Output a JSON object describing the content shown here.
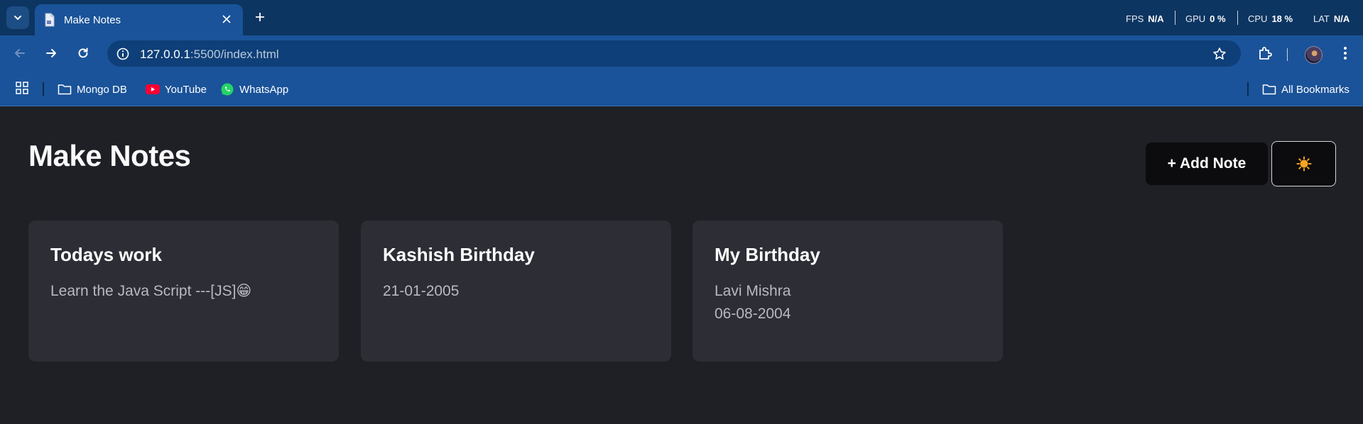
{
  "browser": {
    "tab": {
      "title": "Make Notes"
    },
    "perf": {
      "fps_label": "FPS",
      "fps_value": "N/A",
      "gpu_label": "GPU",
      "gpu_value": "0 %",
      "cpu_label": "CPU",
      "cpu_value": "18 %",
      "lat_label": "LAT",
      "lat_value": "N/A"
    },
    "address": {
      "host": "127.0.0.1",
      "path": ":5500/index.html"
    },
    "bookmarks": [
      {
        "label": "Mongo DB",
        "icon": "folder-icon"
      },
      {
        "label": "YouTube",
        "icon": "youtube-icon"
      },
      {
        "label": "WhatsApp",
        "icon": "whatsapp-icon"
      }
    ],
    "all_bookmarks_label": "All Bookmarks"
  },
  "app": {
    "title": "Make Notes",
    "add_note_label": "+ Add Note",
    "theme_toggle_icon": "sun-icon",
    "notes": [
      {
        "title": "Todays work",
        "body": [
          "Learn the Java Script ---[JS]😁"
        ]
      },
      {
        "title": "Kashish Birthday",
        "body": [
          "21-01-2005"
        ]
      },
      {
        "title": "My Birthday",
        "body": [
          "Lavi Mishra",
          "06-08-2004"
        ]
      }
    ]
  },
  "colors": {
    "tabstrip": "#0d3561",
    "toolbar": "#1a5399",
    "page_bg": "#1f2026",
    "card_bg": "#2c2d35",
    "button_bg": "#0c0c0f"
  }
}
